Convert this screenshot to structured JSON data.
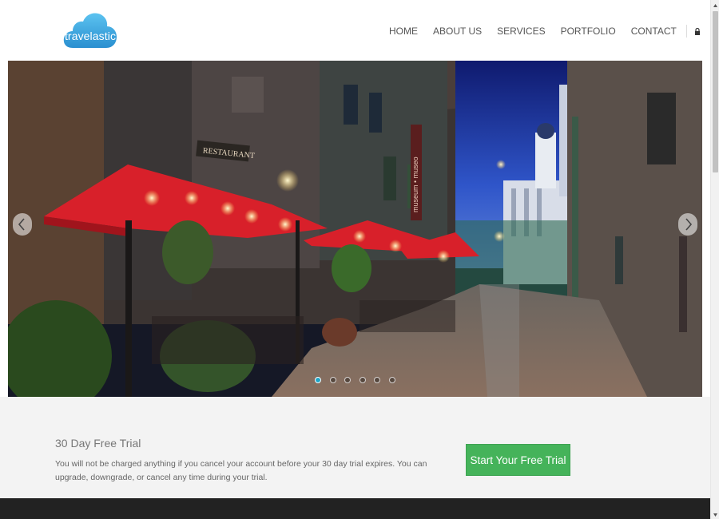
{
  "brand": {
    "name": "travelastic",
    "color": "#3aa7e0"
  },
  "nav": {
    "items": [
      "HOME",
      "ABOUT US",
      "SERVICES",
      "PORTFOLIO",
      "CONTACT"
    ],
    "lock_icon": "lock-icon"
  },
  "slider": {
    "prev_icon": "chevron-left-icon",
    "next_icon": "chevron-right-icon",
    "slide_count": 6,
    "active_slide": 1,
    "sign_text": "RESTAURANT",
    "museum_text": "museum • museo"
  },
  "trial": {
    "title": "30 Day Free Trial",
    "text": "You will not be charged anything if you cancel your account before your 30 day trial expires. You can upgrade, downgrade, or cancel any time during your trial.",
    "button_label": "Start Your Free Trial",
    "button_color": "#45b35a"
  },
  "footer": {
    "color": "#222222"
  }
}
